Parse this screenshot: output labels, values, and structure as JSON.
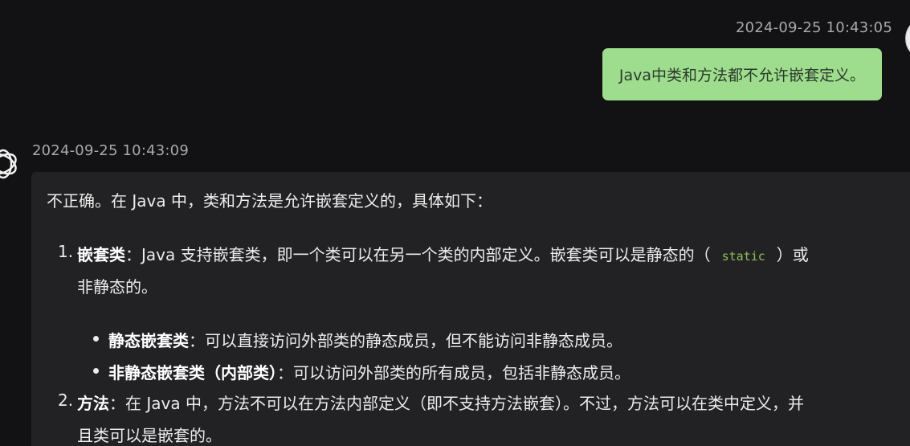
{
  "user_message": {
    "timestamp": "2024-09-25 10:43:05",
    "text": "Java中类和方法都不允许嵌套定义。"
  },
  "assistant_message": {
    "timestamp": "2024-09-25 10:43:09",
    "intro": "不正确。在 Java 中，类和方法是允许嵌套定义的，具体如下：",
    "items": [
      {
        "number": "1.",
        "term": "嵌套类",
        "text_before_code": "：Java 支持嵌套类，即一个类可以在另一个类的内部定义。嵌套类可以是静态的（",
        "code": "static",
        "text_after_code": "）或",
        "continuation": "非静态的。",
        "subitems": [
          {
            "term": "静态嵌套类",
            "text": "：可以直接访问外部类的静态成员，但不能访问非静态成员。"
          },
          {
            "term": "非静态嵌套类（内部类）",
            "text": "：可以访问外部类的所有成员，包括非静态成员。"
          }
        ]
      },
      {
        "number": "2.",
        "term": "方法",
        "text": "：在 Java 中，方法不可以在方法内部定义（即不支持方法嵌套）。不过，方法可以在类中定义，并",
        "continuation": "且类可以是嵌套的。"
      }
    ]
  }
}
